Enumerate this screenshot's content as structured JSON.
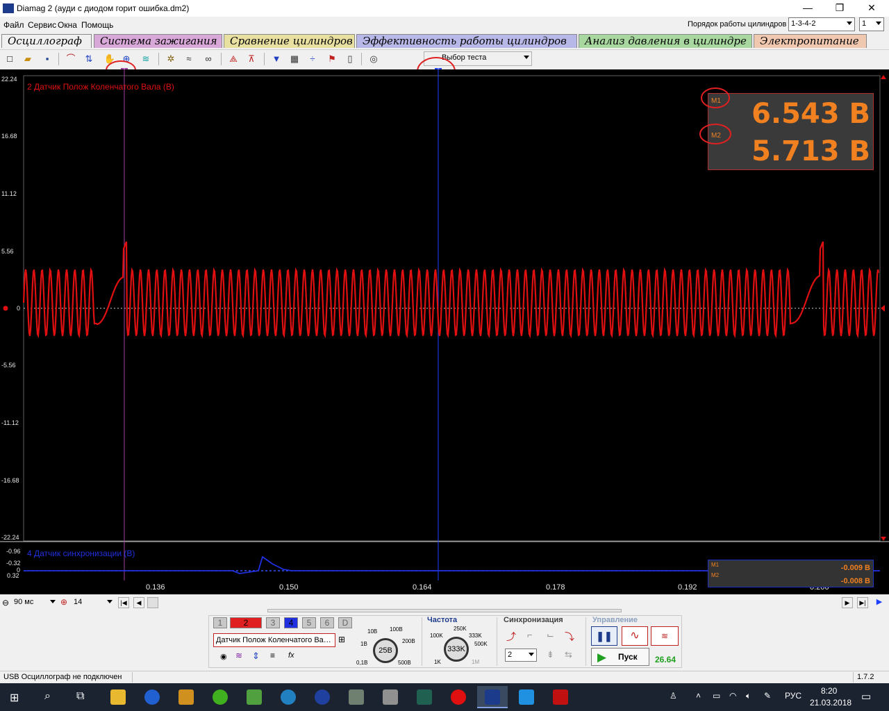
{
  "window": {
    "title": "Diamag 2 (ауди с диодом горит ошибка.dm2)",
    "minimize": "—",
    "maximize": "❐",
    "close": "✕"
  },
  "menu": [
    "Файл",
    "Сервис",
    "Окна",
    "Помощь"
  ],
  "cylinder_order": {
    "label": "Порядок работы цилиндров",
    "value": "1-3-4-2",
    "count": "1"
  },
  "tabs": [
    {
      "label": "Осциллограф",
      "color": "#f0f0f0"
    },
    {
      "label": "Система зажигания",
      "color": "#d8a8d8"
    },
    {
      "label": "Сравнение цилиндров",
      "color": "#e8e0a0"
    },
    {
      "label": "Эффективность работы цилиндров",
      "color": "#b8b8e8"
    },
    {
      "label": "Анализ давления в цилиндре",
      "color": "#a8d8a0"
    },
    {
      "label": "Электропитание",
      "color": "#f0c8b0"
    }
  ],
  "toolbar": {
    "test_select": "Выбор теста",
    "cursor1_label": "1",
    "cursor2_label": "2"
  },
  "scope": {
    "main_channel_title": "2 Датчик Полож Коленчатого Вала (В)",
    "sync_channel_title": "4 Датчик синхронизации (В)",
    "y_ticks": [
      "22.24",
      "16.68",
      "11.12",
      "5.56",
      "0",
      "-5.56",
      "-11.12",
      "-16.68",
      "-22.24"
    ],
    "sync_y_ticks": [
      "-0.96",
      "-0.32",
      "0",
      "0.32"
    ],
    "x_ticks": [
      "0.136",
      "0.150",
      "0.164",
      "0.178",
      "0.192",
      "0.206"
    ],
    "measurements": [
      {
        "tag": "M1",
        "value": "6.543 В"
      },
      {
        "tag": "M2",
        "value": "5.713 В"
      }
    ],
    "sync_measurements": [
      {
        "tag": "M1",
        "value": "-0.009 В"
      },
      {
        "tag": "M2",
        "value": "-0.008 В"
      }
    ],
    "colors": {
      "main": "#e01010",
      "sync": "#2030e0",
      "cursor1": "#a040a0",
      "cursor2": "#2040ff",
      "measure": "#f08020"
    }
  },
  "zoombar": {
    "time_div": "90 мс",
    "zoom": "14"
  },
  "control": {
    "channels": [
      "1",
      "2",
      "3",
      "4",
      "5",
      "6",
      "D"
    ],
    "channel_name": "Датчик Полож Коленчатого Ва",
    "voltage_knob": "25В",
    "voltage_labels": [
      "10В",
      "100В",
      "1В",
      "200В",
      "0,1В",
      "500В"
    ],
    "freq_title": "Частота",
    "freq_knob": "333K",
    "freq_labels": [
      "250K",
      "100K",
      "333K",
      "500K",
      "1K",
      "1M"
    ],
    "sync_title": "Синхронизация",
    "sync_channel": "2",
    "control_title": "Управление",
    "start_label": "Пуск",
    "fps": "26.64"
  },
  "status": {
    "text": "USB Осциллограф не подключен",
    "version": "1.7.2"
  },
  "taskbar": {
    "lang": "РУС",
    "time": "8:20",
    "date": "21.03.2018"
  }
}
